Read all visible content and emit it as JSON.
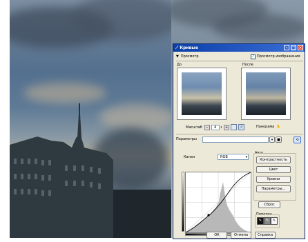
{
  "dialog": {
    "title": "Кривые",
    "preview_label": "Просмотр",
    "preview_image_label": "Просмотр изображения",
    "before_label": "До",
    "after_label": "После",
    "zoom_label": "Масштаб",
    "zoom_value": "4",
    "pan_label": "Панорама",
    "params_label": "Параметры",
    "channel_label": "Канал",
    "channel_value": "RGB",
    "auto_group_label": "Авто",
    "btn_contrast": "Контрастность",
    "btn_color": "Цвет",
    "btn_levels": "Уровни",
    "btn_params": "Параметры...",
    "btn_reset": "Сброс",
    "pipettes_label": "Пипетки",
    "ok": "ОК",
    "cancel": "Отмена",
    "help": "Справка"
  }
}
